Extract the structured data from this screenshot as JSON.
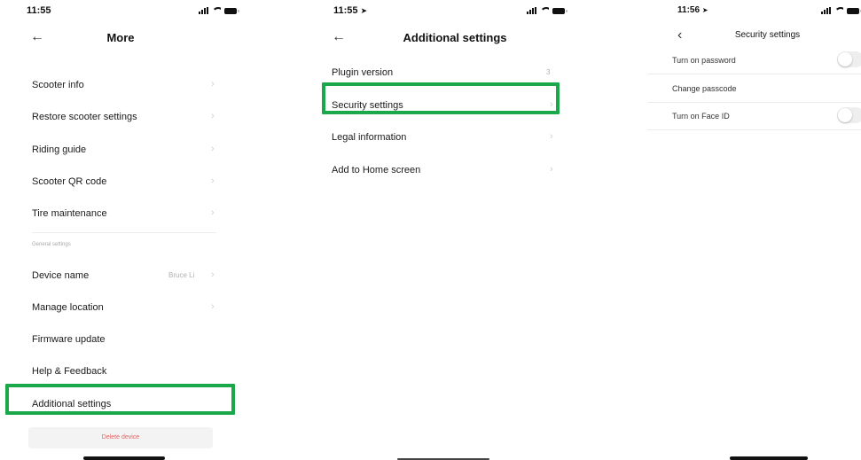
{
  "screen1": {
    "time": "11:55",
    "title": "More",
    "items": [
      {
        "label": "Scooter info",
        "value": ""
      },
      {
        "label": "Restore scooter settings",
        "value": ""
      },
      {
        "label": "Riding guide",
        "value": ""
      },
      {
        "label": "Scooter QR code",
        "value": ""
      },
      {
        "label": "Tire maintenance",
        "value": ""
      }
    ],
    "section_general": "General settings",
    "general_items": [
      {
        "label": "Device name",
        "value": "Bruce Li"
      },
      {
        "label": "Manage location",
        "value": ""
      },
      {
        "label": "Firmware update",
        "value": ""
      },
      {
        "label": "Help & Feedback",
        "value": ""
      },
      {
        "label": "Additional settings",
        "value": ""
      }
    ],
    "delete_label": "Delete device"
  },
  "screen2": {
    "time": "11:55",
    "title": "Additional settings",
    "items": [
      {
        "label": "Plugin version",
        "value": "3"
      },
      {
        "label": "Security settings",
        "value": ""
      },
      {
        "label": "Legal information",
        "value": ""
      },
      {
        "label": "Add to Home screen",
        "value": ""
      }
    ]
  },
  "screen3": {
    "time": "11:56",
    "title": "Security settings",
    "items": [
      {
        "label": "Turn on password"
      },
      {
        "label": "Change passcode"
      },
      {
        "label": "Turn on Face ID"
      }
    ]
  },
  "highlight_color": "#1aa84a",
  "icons": {
    "back": "←",
    "back_thin": "‹",
    "chevron": "›",
    "location_arrow": "➤"
  }
}
